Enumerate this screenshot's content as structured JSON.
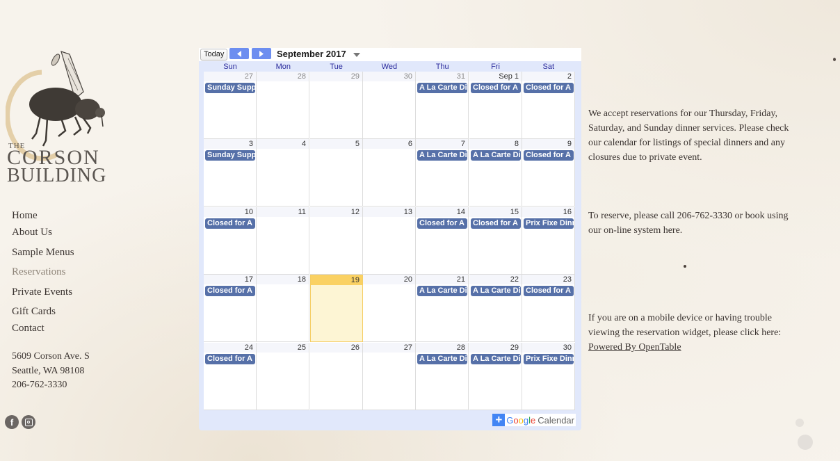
{
  "brand": {
    "line1": "THE",
    "line2": "CORSON",
    "line3": "BUILDING",
    "accent_color": "#e4cfa8"
  },
  "nav": [
    {
      "label": "Home",
      "active": false
    },
    {
      "label": "About Us",
      "active": false
    },
    {
      "label": "Sample Menus",
      "active": false
    },
    {
      "label": "Reservations",
      "active": true
    },
    {
      "label": "Private Events",
      "active": false
    },
    {
      "label": "Gift Cards",
      "active": false
    },
    {
      "label": "Contact",
      "active": false
    }
  ],
  "address": {
    "street": "5609 Corson Ave. S",
    "city": "Seattle, WA 98108",
    "phone": "206-762-3330"
  },
  "social": [
    {
      "icon": "facebook-icon",
      "glyph": "f"
    },
    {
      "icon": "instagram-icon"
    }
  ],
  "calendar": {
    "today_label": "Today",
    "month_title": "September 2017",
    "weekdays": [
      "Sun",
      "Mon",
      "Tue",
      "Wed",
      "Thu",
      "Fri",
      "Sat"
    ],
    "event_color": "#5670a8",
    "today_color": "#fad163",
    "weeks": [
      [
        {
          "d": "27",
          "other": true,
          "e": "Sunday Supper"
        },
        {
          "d": "28",
          "other": true
        },
        {
          "d": "29",
          "other": true
        },
        {
          "d": "30",
          "other": true
        },
        {
          "d": "31",
          "other": true,
          "e": "A La Carte Dinner"
        },
        {
          "d": "Sep 1",
          "e": "Closed for A"
        },
        {
          "d": "2",
          "e": "Closed for A"
        }
      ],
      [
        {
          "d": "3",
          "e": "Sunday Supper"
        },
        {
          "d": "4"
        },
        {
          "d": "5"
        },
        {
          "d": "6"
        },
        {
          "d": "7",
          "e": "A La Carte Dinner"
        },
        {
          "d": "8",
          "e": "A La Carte Dinner"
        },
        {
          "d": "9",
          "e": "Closed for A"
        }
      ],
      [
        {
          "d": "10",
          "e": "Closed for A"
        },
        {
          "d": "11"
        },
        {
          "d": "12"
        },
        {
          "d": "13"
        },
        {
          "d": "14",
          "e": "Closed for A"
        },
        {
          "d": "15",
          "e": "Closed for A"
        },
        {
          "d": "16",
          "e": "Prix Fixe Dinner"
        }
      ],
      [
        {
          "d": "17",
          "e": "Closed for A"
        },
        {
          "d": "18"
        },
        {
          "d": "19",
          "today": true
        },
        {
          "d": "20"
        },
        {
          "d": "21",
          "e": "A La Carte Dinner"
        },
        {
          "d": "22",
          "e": "A La Carte Dinner"
        },
        {
          "d": "23",
          "e": "Closed for A"
        }
      ],
      [
        {
          "d": "24",
          "e": "Closed for A"
        },
        {
          "d": "25"
        },
        {
          "d": "26"
        },
        {
          "d": "27"
        },
        {
          "d": "28",
          "e": "A La Carte Dinner"
        },
        {
          "d": "29",
          "e": "A La Carte Dinner"
        },
        {
          "d": "30",
          "e": "Prix Fixe Dinner"
        }
      ]
    ],
    "footer": {
      "plus": "+",
      "google": [
        "G",
        "o",
        "o",
        "g",
        "l",
        "e"
      ],
      "calendar_label": "Calendar"
    }
  },
  "info": {
    "p1": "We accept reservations for our Thursday, Friday, Saturday, and Sunday dinner services. Please check our calendar for listings of special dinners and any closures due to private event.",
    "p2": "To reserve, please call 206-762-3330 or book using our on-line system here.",
    "p3": "If you are on a mobile device or having trouble viewing the reservation widget, please click here:",
    "link": "Powered By OpenTable"
  }
}
